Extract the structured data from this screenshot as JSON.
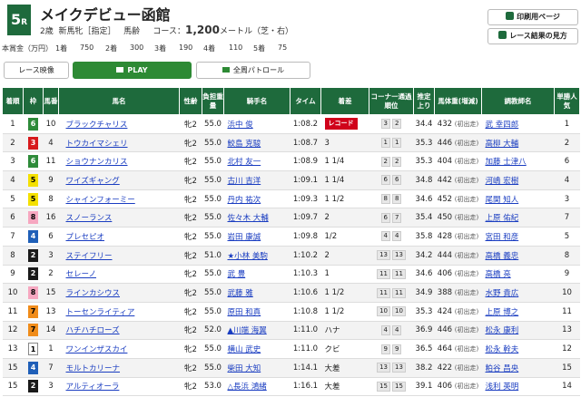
{
  "race": {
    "number": "5",
    "suffix": "R",
    "title": "メイクデビュー函館",
    "age": "2歳",
    "class": "新馬牝［指定］",
    "weight_rule": "馬齢",
    "course_label": "コース：",
    "distance": "1,200",
    "unit_surface": "メートル（芝・右）"
  },
  "side_buttons": {
    "print": "印刷用ページ",
    "results_guide": "レース結果の見方"
  },
  "prize": {
    "label": "本賞金（万円）",
    "entries": [
      {
        "place": "1着",
        "amount": "750"
      },
      {
        "place": "2着",
        "amount": "300"
      },
      {
        "place": "3着",
        "amount": "190"
      },
      {
        "place": "4着",
        "amount": "110"
      },
      {
        "place": "5着",
        "amount": "75"
      }
    ]
  },
  "controls": {
    "video": "レース映像",
    "play": "PLAY",
    "patrol": "全周パトロール"
  },
  "colors": {
    "brand_green": "#1e6a3c",
    "play_green": "#2d8a34",
    "record_red": "#d0021b"
  },
  "headers": {
    "rank": "着順",
    "waku": "枠",
    "umaban": "馬番",
    "horse": "馬名",
    "sex_age": "性齢",
    "weight": "負担重量",
    "jockey": "騎手名",
    "time": "タイム",
    "margin": "着差",
    "corner": "コーナー通過順位",
    "last3f": "推定上り",
    "body_weight": "馬体重(増減)",
    "trainer": "調教師名",
    "popularity": "単勝人気"
  },
  "waku_colors": {
    "1": {
      "bg": "#ffffff",
      "fg": "#000000"
    },
    "2": {
      "bg": "#1a1a1a",
      "fg": "#ffffff"
    },
    "3": {
      "bg": "#d7191c",
      "fg": "#ffffff"
    },
    "4": {
      "bg": "#1f5fb8",
      "fg": "#ffffff"
    },
    "5": {
      "bg": "#f4e000",
      "fg": "#000000"
    },
    "6": {
      "bg": "#2e8b3a",
      "fg": "#ffffff"
    },
    "7": {
      "bg": "#f08c1a",
      "fg": "#000000"
    },
    "8": {
      "bg": "#f6a7c0",
      "fg": "#000000"
    }
  },
  "rows": [
    {
      "rank": "1",
      "waku": "6",
      "umaban": "10",
      "horse": "ブラックチャリス",
      "sex_age": "牝2",
      "weight": "55.0",
      "jockey": "浜中 俊",
      "time": "1:08.2",
      "margin": "",
      "record": "レコード",
      "corner": [
        "3",
        "2"
      ],
      "last3f": "34.4",
      "body": "432",
      "diff": "(初出走)",
      "trainer": "武 幸四郎",
      "pop": "1"
    },
    {
      "rank": "2",
      "waku": "3",
      "umaban": "4",
      "horse": "トウカイマシェリ",
      "sex_age": "牝2",
      "weight": "55.0",
      "jockey": "鮫島 克駿",
      "time": "1:08.7",
      "margin": "3",
      "record": "",
      "corner": [
        "1",
        "1"
      ],
      "last3f": "35.3",
      "body": "446",
      "diff": "(初出走)",
      "trainer": "高柳 大輔",
      "pop": "2"
    },
    {
      "rank": "3",
      "waku": "6",
      "umaban": "11",
      "horse": "ショウナンカリス",
      "sex_age": "牝2",
      "weight": "55.0",
      "jockey": "北村 友一",
      "time": "1:08.9",
      "margin": "1 1/4",
      "record": "",
      "corner": [
        "2",
        "2"
      ],
      "last3f": "35.3",
      "body": "404",
      "diff": "(初出走)",
      "trainer": "加藤 士津八",
      "pop": "6"
    },
    {
      "rank": "4",
      "waku": "5",
      "umaban": "9",
      "horse": "ワイズギャング",
      "sex_age": "牝2",
      "weight": "55.0",
      "jockey": "古川 吉洋",
      "time": "1:09.1",
      "margin": "1 1/4",
      "record": "",
      "corner": [
        "6",
        "6"
      ],
      "last3f": "34.8",
      "body": "442",
      "diff": "(初出走)",
      "trainer": "河嶋 宏樹",
      "pop": "4"
    },
    {
      "rank": "5",
      "waku": "5",
      "umaban": "8",
      "horse": "シャインフォーミー",
      "sex_age": "牝2",
      "weight": "55.0",
      "jockey": "丹内 祐次",
      "time": "1:09.3",
      "margin": "1 1/2",
      "record": "",
      "corner": [
        "8",
        "8"
      ],
      "last3f": "34.6",
      "body": "452",
      "diff": "(初出走)",
      "trainer": "尾関 知人",
      "pop": "3"
    },
    {
      "rank": "6",
      "waku": "8",
      "umaban": "16",
      "horse": "スノーランス",
      "sex_age": "牝2",
      "weight": "55.0",
      "jockey": "佐々木 大輔",
      "time": "1:09.7",
      "margin": "2",
      "record": "",
      "corner": [
        "6",
        "7"
      ],
      "last3f": "35.4",
      "body": "450",
      "diff": "(初出走)",
      "trainer": "上原 佑紀",
      "pop": "7"
    },
    {
      "rank": "7",
      "waku": "4",
      "umaban": "6",
      "horse": "プレセピオ",
      "sex_age": "牝2",
      "weight": "55.0",
      "jockey": "岩田 康誠",
      "time": "1:09.8",
      "margin": "1/2",
      "record": "",
      "corner": [
        "4",
        "4"
      ],
      "last3f": "35.8",
      "body": "428",
      "diff": "(初出走)",
      "trainer": "宮田 和彦",
      "pop": "5"
    },
    {
      "rank": "8",
      "waku": "2",
      "umaban": "3",
      "horse": "ステイフリー",
      "sex_age": "牝2",
      "weight": "51.0",
      "jockey": "★小林 美駒",
      "time": "1:10.2",
      "margin": "2",
      "record": "",
      "corner": [
        "13",
        "13"
      ],
      "last3f": "34.2",
      "body": "444",
      "diff": "(初出走)",
      "trainer": "高橋 義忠",
      "pop": "8"
    },
    {
      "rank": "9",
      "waku": "2",
      "umaban": "2",
      "horse": "セレーノ",
      "sex_age": "牝2",
      "weight": "55.0",
      "jockey": "武 豊",
      "time": "1:10.3",
      "margin": "1",
      "record": "",
      "corner": [
        "11",
        "11"
      ],
      "last3f": "34.6",
      "body": "406",
      "diff": "(初出走)",
      "trainer": "高橋 亮",
      "pop": "9"
    },
    {
      "rank": "10",
      "waku": "8",
      "umaban": "15",
      "horse": "ラインカシウス",
      "sex_age": "牝2",
      "weight": "55.0",
      "jockey": "武藤 雅",
      "time": "1:10.6",
      "margin": "1 1/2",
      "record": "",
      "corner": [
        "11",
        "11"
      ],
      "last3f": "34.9",
      "body": "388",
      "diff": "(初出走)",
      "trainer": "水野 貴広",
      "pop": "10"
    },
    {
      "rank": "11",
      "waku": "7",
      "umaban": "13",
      "horse": "トーセンライティア",
      "sex_age": "牝2",
      "weight": "55.0",
      "jockey": "原田 和真",
      "time": "1:10.8",
      "margin": "1 1/2",
      "record": "",
      "corner": [
        "10",
        "10"
      ],
      "last3f": "35.3",
      "body": "424",
      "diff": "(初出走)",
      "trainer": "上原 博之",
      "pop": "11"
    },
    {
      "rank": "12",
      "waku": "7",
      "umaban": "14",
      "horse": "ハチハチローズ",
      "sex_age": "牝2",
      "weight": "52.0",
      "jockey": "▲川端 海翼",
      "time": "1:11.0",
      "margin": "ハナ",
      "record": "",
      "corner": [
        "4",
        "4"
      ],
      "last3f": "36.9",
      "body": "446",
      "diff": "(初出走)",
      "trainer": "松永 康利",
      "pop": "13"
    },
    {
      "rank": "13",
      "waku": "1",
      "umaban": "1",
      "horse": "ワンインザスカイ",
      "sex_age": "牝2",
      "weight": "55.0",
      "jockey": "横山 武史",
      "time": "1:11.0",
      "margin": "クビ",
      "record": "",
      "corner": [
        "9",
        "9"
      ],
      "last3f": "36.5",
      "body": "464",
      "diff": "(初出走)",
      "trainer": "松永 幹夫",
      "pop": "12"
    },
    {
      "rank": "15",
      "waku": "4",
      "umaban": "7",
      "horse": "モルトカリーナ",
      "sex_age": "牝2",
      "weight": "55.0",
      "jockey": "柴田 大知",
      "time": "1:14.1",
      "margin": "大差",
      "record": "",
      "corner": [
        "13",
        "13"
      ],
      "last3f": "38.2",
      "body": "422",
      "diff": "(初出走)",
      "trainer": "粕谷 昌央",
      "pop": "15"
    },
    {
      "rank": "15",
      "waku": "2",
      "umaban": "3",
      "horse": "アルティオーラ",
      "sex_age": "牝2",
      "weight": "53.0",
      "jockey": "△長浜 鴻緒",
      "time": "1:16.1",
      "margin": "大差",
      "record": "",
      "corner": [
        "15",
        "15"
      ],
      "last3f": "39.1",
      "body": "406",
      "diff": "(初出走)",
      "trainer": "浅利 英明",
      "pop": "14"
    }
  ]
}
